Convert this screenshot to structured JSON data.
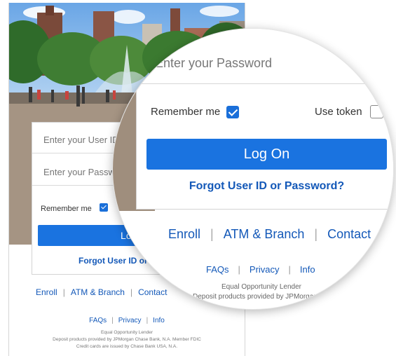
{
  "login": {
    "user_id_placeholder": "Enter your User ID",
    "password_placeholder": "Enter your Password",
    "remember_label": "Remember me",
    "remember_checked": true,
    "token_label": "Use token",
    "token_checked": false,
    "logon_label": "Log On",
    "forgot_label": "Forgot User ID or Password?"
  },
  "links": [
    "Enroll",
    "ATM & Branch",
    "Contact"
  ],
  "small_links": [
    "FAQs",
    "Privacy",
    "Info"
  ],
  "legal": [
    "Equal Opportunity Lender",
    "Deposit products provided by JPMorgan Chase Bank, N.A. Member FDIC",
    "Credit cards are issued by Chase Bank USA, N.A."
  ],
  "colors": {
    "primary": "#1a73e0",
    "link": "#1358b8",
    "checkbox": "#1a6fd9"
  }
}
